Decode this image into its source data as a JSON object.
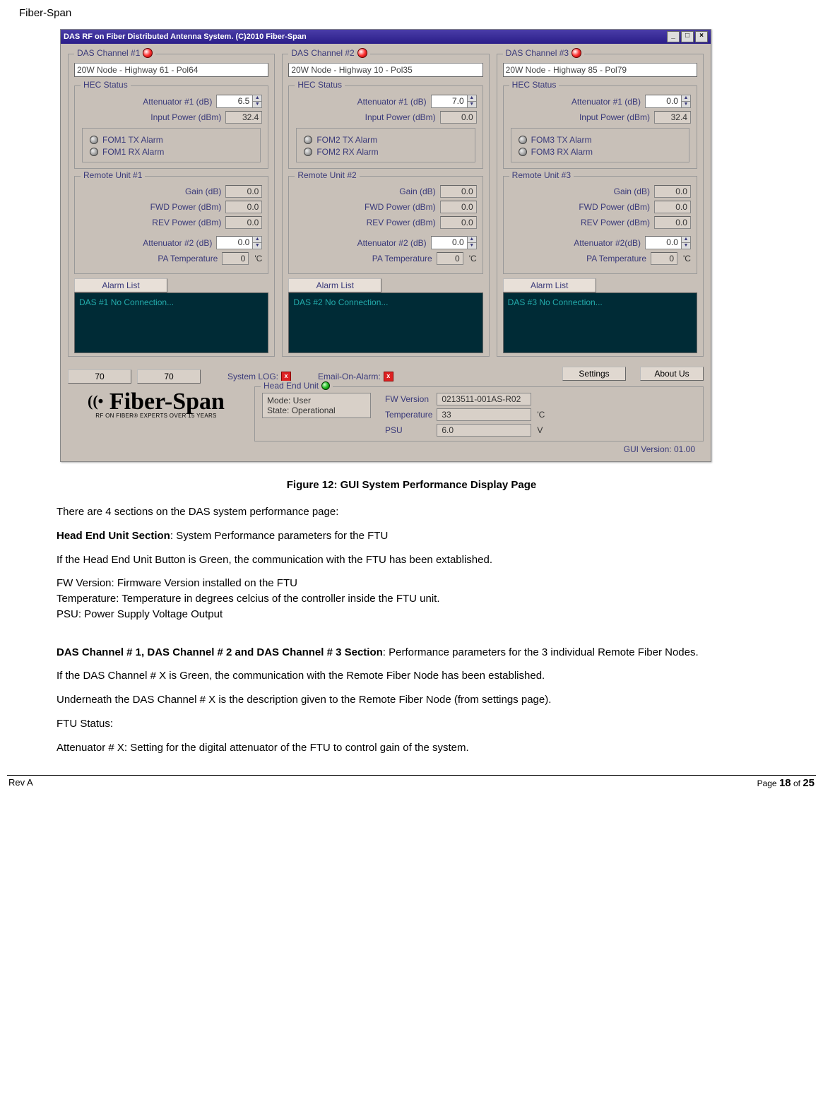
{
  "doc": {
    "header": "Fiber-Span",
    "figure_caption": "Figure 12: GUI System Performance Display Page",
    "p1": "There are 4 sections on the DAS system performance page:",
    "p2_bold": "Head End Unit Section",
    "p2_rest": ": System Performance parameters for the FTU",
    "p3": "If the Head End Unit Button is Green, the communication with the FTU has been extablished.",
    "p4a": "FW Version: Firmware Version installed on the FTU",
    "p4b": "Temperature: Temperature in degrees celcius of the controller inside the FTU unit.",
    "p4c": "PSU: Power Supply Voltage Output",
    "p5_bold": "DAS Channel # 1, DAS Channel # 2 and DAS Channel # 3 Section",
    "p5_rest": ":  Performance parameters for the 3 individual Remote Fiber Nodes.",
    "p6": "If the DAS Channel # X is Green, the communication with the Remote Fiber Node has been established.",
    "p7": "Underneath the DAS Channel # X is the description given to the Remote Fiber Node (from settings page).",
    "p8": "FTU Status:",
    "p9": "Attenuator # X:  Setting  for the digital attenuator of the FTU to control gain of the system.",
    "footer_rev": "Rev A",
    "footer_page_pre": "Page ",
    "footer_page_cur": "18",
    "footer_page_mid": " of ",
    "footer_page_tot": "25"
  },
  "app": {
    "titlebar": "DAS RF on Fiber Distributed Antenna System. (C)2010 Fiber-Span",
    "channels": [
      {
        "title": "DAS Channel #1",
        "desc": "20W Node - Highway 61 - Pol64",
        "hec": {
          "title": "HEC Status",
          "att_lbl": "Attenuator #1 (dB)",
          "att_val": "6.5",
          "ip_lbl": "Input Power (dBm)",
          "ip_val": "32.4",
          "tx_alarm": "FOM1 TX Alarm",
          "rx_alarm": "FOM1 RX Alarm"
        },
        "ru": {
          "title": "Remote Unit #1",
          "gain_lbl": "Gain (dB)",
          "gain_val": "0.0",
          "fwd_lbl": "FWD Power (dBm)",
          "fwd_val": "0.0",
          "rev_lbl": "REV Power (dBm)",
          "rev_val": "0.0",
          "att_lbl": "Attenuator #2 (dB)",
          "att_val": "0.0",
          "temp_lbl": "PA Temperature",
          "temp_val": "0",
          "temp_unit": "'C"
        },
        "alarm_btn": "Alarm List",
        "alarm_text": "DAS #1 No Connection..."
      },
      {
        "title": "DAS Channel #2",
        "desc": "20W Node - Highway 10 - Pol35",
        "hec": {
          "title": "HEC Status",
          "att_lbl": "Attenuator #1 (dB)",
          "att_val": "7.0",
          "ip_lbl": "Input Power (dBm)",
          "ip_val": "0.0",
          "tx_alarm": "FOM2 TX Alarm",
          "rx_alarm": "FOM2 RX Alarm"
        },
        "ru": {
          "title": "Remote Unit #2",
          "gain_lbl": "Gain (dB)",
          "gain_val": "0.0",
          "fwd_lbl": "FWD Power (dBm)",
          "fwd_val": "0.0",
          "rev_lbl": "REV Power (dBm)",
          "rev_val": "0.0",
          "att_lbl": "Attenuator #2 (dB)",
          "att_val": "0.0",
          "temp_lbl": "PA Temperature",
          "temp_val": "0",
          "temp_unit": "'C"
        },
        "alarm_btn": "Alarm List",
        "alarm_text": "DAS #2 No Connection..."
      },
      {
        "title": "DAS Channel #3",
        "desc": "20W Node - Highway 85 - Pol79",
        "hec": {
          "title": "HEC Status",
          "att_lbl": "Attenuator #1 (dB)",
          "att_val": "0.0",
          "ip_lbl": "Input Power (dBm)",
          "ip_val": "32.4",
          "tx_alarm": "FOM3 TX Alarm",
          "rx_alarm": "FOM3 RX Alarm"
        },
        "ru": {
          "title": "Remote Unit #3",
          "gain_lbl": "Gain (dB)",
          "gain_val": "0.0",
          "fwd_lbl": "FWD Power (dBm)",
          "fwd_val": "0.0",
          "rev_lbl": "REV Power (dBm)",
          "rev_val": "0.0",
          "att_lbl": "Attenuator #2(dB)",
          "att_val": "0.0",
          "temp_lbl": "PA Temperature",
          "temp_val": "0",
          "temp_unit": "'C"
        },
        "alarm_btn": "Alarm List",
        "alarm_text": "DAS #3 No Connection..."
      }
    ],
    "meters": {
      "m1": "70",
      "m2": "70",
      "syslog_lbl": "System LOG:",
      "email_lbl": "Email-On-Alarm:",
      "settings_btn": "Settings",
      "about_btn": "About Us"
    },
    "heu": {
      "title": "Head End Unit",
      "mode_line": "Mode: User",
      "state_line": "State: Operational",
      "fw_lbl": "FW Version",
      "fw_val": "0213511-001AS-R02",
      "temp_lbl": "Temperature",
      "temp_val": "33",
      "temp_unit": "'C",
      "psu_lbl": "PSU",
      "psu_val": "6.0",
      "psu_unit": "V"
    },
    "gui_ver": "GUI Version: 01.00",
    "logo_main": "Fiber-Span",
    "logo_sub": "RF ON FIBER® EXPERTS OVER 15 YEARS"
  }
}
